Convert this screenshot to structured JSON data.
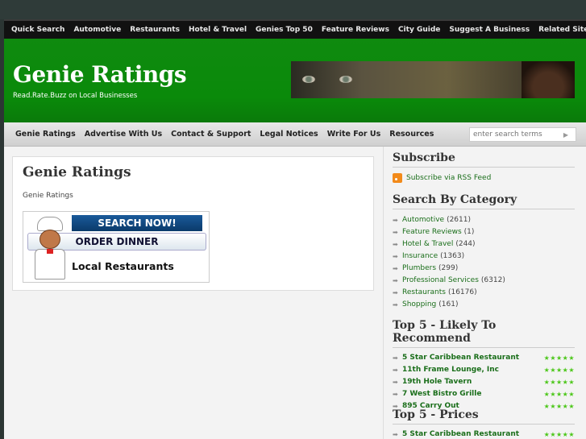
{
  "top_nav": [
    "Quick Search",
    "Automotive",
    "Restaurants",
    "Hotel & Travel",
    "Genies Top 50",
    "Feature Reviews",
    "City Guide",
    "Suggest A Business",
    "Related Sites"
  ],
  "header": {
    "site_title": "Genie Ratings",
    "tagline": "Read.Rate.Buzz on Local Businesses"
  },
  "sub_nav": [
    "Genie Ratings",
    "Advertise With Us",
    "Contact & Support",
    "Legal Notices",
    "Write For Us",
    "Resources"
  ],
  "search": {
    "placeholder": "enter search terms",
    "go_glyph": "▶"
  },
  "content": {
    "title": "Genie Ratings",
    "breadcrumb": "Genie Ratings",
    "ad": {
      "line1": "SEARCH NOW!",
      "line2": "ORDER DINNER",
      "line3": "Local Restaurants"
    }
  },
  "sidebar": {
    "subscribe": {
      "title": "Subscribe",
      "rss_label": "Subscribe via RSS Feed"
    },
    "categories": {
      "title": "Search By Category",
      "items": [
        {
          "label": "Automotive",
          "count": "(2611)"
        },
        {
          "label": "Feature Reviews",
          "count": "(1)"
        },
        {
          "label": "Hotel & Travel",
          "count": "(244)"
        },
        {
          "label": "Insurance",
          "count": "(1363)"
        },
        {
          "label": "Plumbers",
          "count": "(299)"
        },
        {
          "label": "Professional Services",
          "count": "(6312)"
        },
        {
          "label": "Restaurants",
          "count": "(16176)"
        },
        {
          "label": "Shopping",
          "count": "(161)"
        }
      ]
    },
    "likely": {
      "title": "Top 5 - Likely To Recommend",
      "items": [
        {
          "label": "5 Star Caribbean Restaurant",
          "stars": "★★★★★"
        },
        {
          "label": "11th Frame Lounge, Inc",
          "stars": "★★★★★"
        },
        {
          "label": "19th Hole Tavern",
          "stars": "★★★★★"
        },
        {
          "label": "7 West Bistro Grille",
          "stars": "★★★★★"
        },
        {
          "label": "895 Carry Out",
          "stars": "★★★★★"
        }
      ]
    },
    "prices": {
      "title": "Top 5 - Prices",
      "items": [
        {
          "label": "5 Star Caribbean Restaurant",
          "stars": "★★★★★"
        }
      ]
    }
  },
  "colors": {
    "header_green": "#0a8a0a",
    "link_green": "#1a6e1a",
    "star_green": "#4cc71a"
  }
}
